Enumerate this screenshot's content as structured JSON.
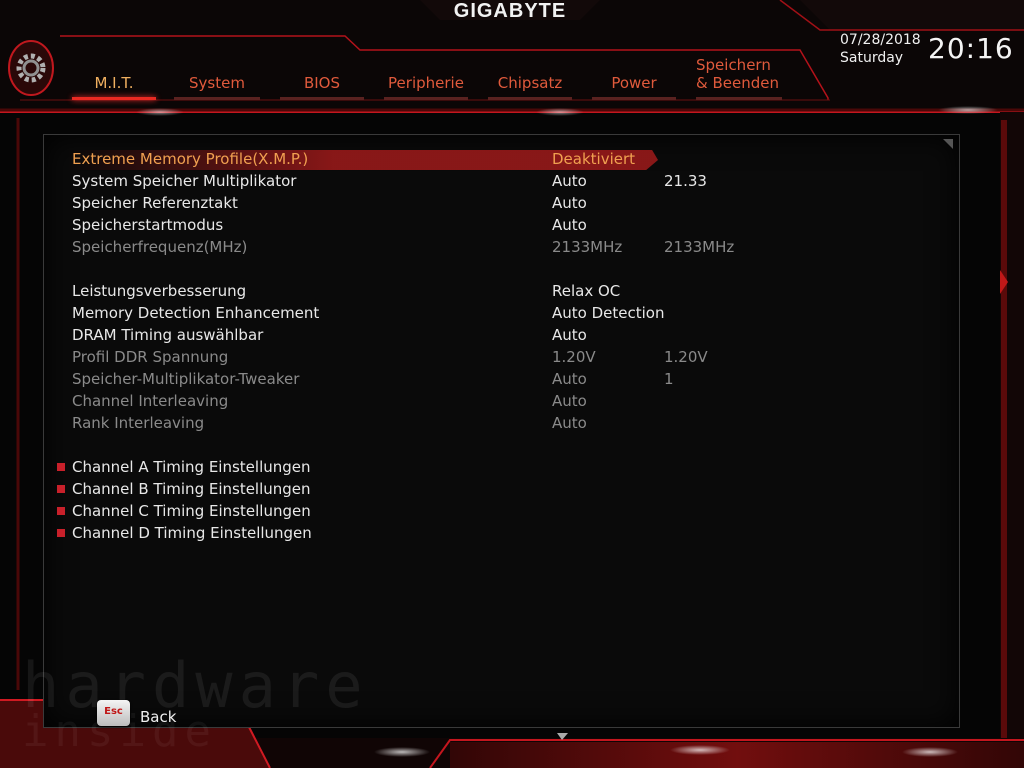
{
  "header": {
    "brand": "GIGABYTE",
    "date": "07/28/2018",
    "day": "Saturday",
    "time": "20:16"
  },
  "tabs": [
    {
      "label": "M.I.T.",
      "active": true
    },
    {
      "label": "System"
    },
    {
      "label": "BIOS"
    },
    {
      "label": "Peripherie"
    },
    {
      "label": "Chipsatz"
    },
    {
      "label": "Power"
    },
    {
      "label_line1": "Speichern",
      "label_line2": "& Beenden"
    }
  ],
  "settings": [
    {
      "label": "Extreme Memory Profile(X.M.P.)",
      "value": "Deaktiviert",
      "value2": ""
    },
    {
      "label": "System Speicher Multiplikator",
      "value": "Auto",
      "value2": "21.33"
    },
    {
      "label": "Speicher Referenztakt",
      "value": "Auto",
      "value2": ""
    },
    {
      "label": "Speicherstartmodus",
      "value": "Auto",
      "value2": ""
    },
    {
      "label": "Speicherfrequenz(MHz)",
      "value": "2133MHz",
      "value2": "2133MHz"
    },
    {
      "label": "Leistungsverbesserung",
      "value": "Relax OC",
      "value2": ""
    },
    {
      "label": "Memory Detection Enhancement",
      "value": "Auto Detection",
      "value2": ""
    },
    {
      "label": "DRAM Timing auswählbar",
      "value": "Auto",
      "value2": ""
    },
    {
      "label": "Profil DDR Spannung",
      "value": "1.20V",
      "value2": "1.20V"
    },
    {
      "label": "Speicher-Multiplikator-Tweaker",
      "value": "Auto",
      "value2": "1"
    },
    {
      "label": "Channel Interleaving",
      "value": "Auto",
      "value2": ""
    },
    {
      "label": "Rank Interleaving",
      "value": "Auto",
      "value2": ""
    }
  ],
  "submenus": [
    {
      "label": "Channel A Timing Einstellungen"
    },
    {
      "label": "Channel B Timing Einstellungen"
    },
    {
      "label": "Channel C Timing Einstellungen"
    },
    {
      "label": "Channel D Timing Einstellungen"
    }
  ],
  "footer": {
    "esc_key": "Esc",
    "back_label": "Back",
    "watermark_line1": "hardware",
    "watermark_line2": "inside"
  },
  "colors": {
    "accent_red": "#e82a22",
    "tab_text": "#e05a3c",
    "active_tab_text": "#f0b060",
    "disabled_text": "#8a8a8a",
    "bullet": "#c8202a"
  },
  "icons": {
    "gear": "gear-icon",
    "corner": "panel-corner-icon",
    "bullet": "submenu-bullet-icon"
  }
}
